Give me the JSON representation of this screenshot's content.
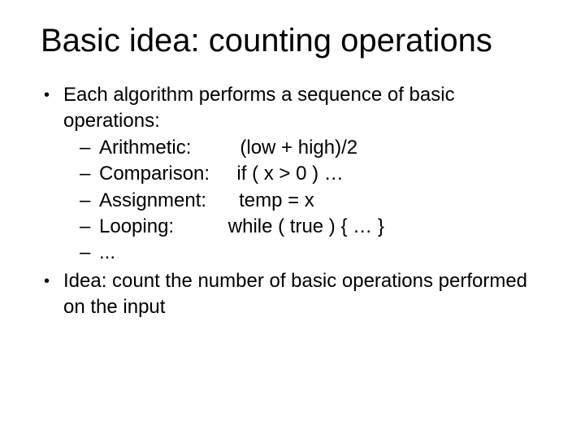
{
  "title": "Basic idea: counting operations",
  "bullets": {
    "b1": "Each algorithm performs a sequence of basic operations:",
    "sub": {
      "arithmetic": "Arithmetic:         (low + high)/2",
      "comparison": "Comparison:     if ( x > 0 ) …",
      "assignment": "Assignment:      temp = x",
      "looping": "Looping:          while ( true ) { … }",
      "more": "..."
    },
    "b2": "Idea: count the number of basic operations performed on the input"
  }
}
